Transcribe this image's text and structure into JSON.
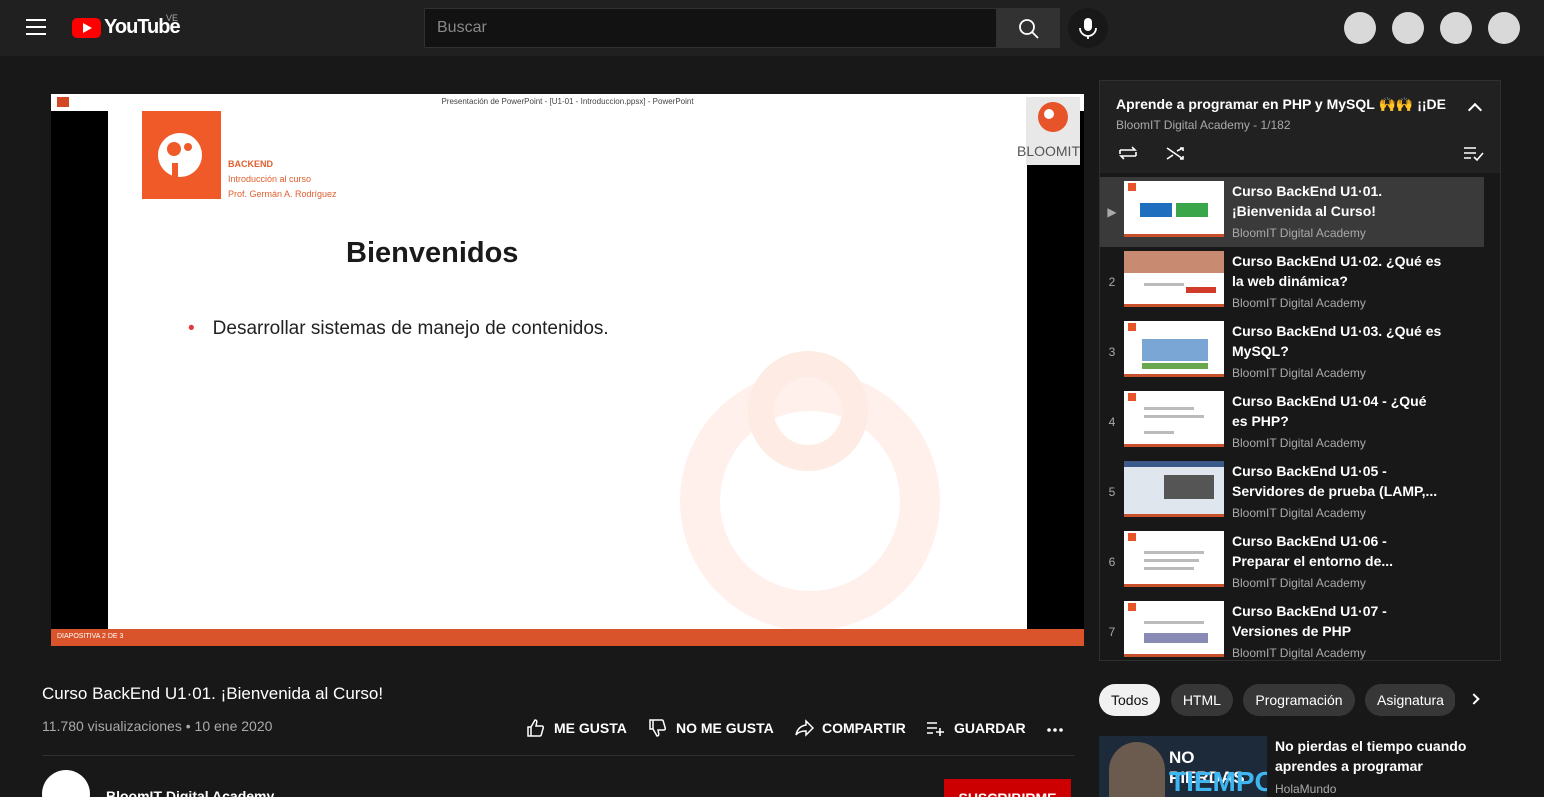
{
  "header": {
    "logo_text": "YouTube",
    "country_code": "VE",
    "search_placeholder": "Buscar"
  },
  "player": {
    "window_title": "Presentación de PowerPoint - [U1-01 - Introduccion.ppsx] - PowerPoint",
    "slide": {
      "section": "BACKEND",
      "subtitle": "Introducción al curso",
      "author": "Prof. Germán A. Rodríguez",
      "heading": "Bienvenidos",
      "bullet": "Desarrollar sistemas de manejo de contenidos.",
      "brand": "BLOOMIT"
    },
    "status": "DIAPOSITIVA 2 DE 3"
  },
  "video": {
    "title": "Curso BackEnd U1·01. ¡Bienvenida al Curso!",
    "views": "11.780 visualizaciones",
    "date": "10 ene 2020",
    "like_label": "ME GUSTA",
    "dislike_label": "NO ME GUSTA",
    "share_label": "COMPARTIR",
    "save_label": "GUARDAR"
  },
  "channel": {
    "name": "BloomIT Digital Academy",
    "subscribe_label": "SUSCRIBIRME"
  },
  "playlist": {
    "title": "Aprende a programar en PHP y MySQL 🙌🙌 ¡¡DE",
    "subtitle": "BloomIT Digital Academy - 1/182",
    "items": [
      {
        "index": "▶",
        "title": "Curso BackEnd U1·01. ¡Bienvenida al Curso!",
        "channel": "BloomIT Digital Academy"
      },
      {
        "index": "2",
        "title": "Curso BackEnd U1·02. ¿Qué es la web dinámica?",
        "channel": "BloomIT Digital Academy"
      },
      {
        "index": "3",
        "title": "Curso BackEnd U1·03. ¿Qué es MySQL?",
        "channel": "BloomIT Digital Academy"
      },
      {
        "index": "4",
        "title": "Curso BackEnd U1·04 - ¿Qué es PHP?",
        "channel": "BloomIT Digital Academy"
      },
      {
        "index": "5",
        "title": "Curso BackEnd U1·05 - Servidores de prueba (LAMP,...",
        "channel": "BloomIT Digital Academy"
      },
      {
        "index": "6",
        "title": "Curso BackEnd U1·06 - Preparar el entorno de...",
        "channel": "BloomIT Digital Academy"
      },
      {
        "index": "7",
        "title": "Curso BackEnd U1·07 - Versiones de PHP",
        "channel": "BloomIT Digital Academy"
      }
    ]
  },
  "chips": [
    "Todos",
    "HTML",
    "Programación",
    "Asignatura"
  ],
  "recommended": {
    "thumb_line1": "NO PIERDAS",
    "thumb_line2": "TIEMPO",
    "title": "No pierdas el tiempo cuando aprendes a programar",
    "channel": "HolaMundo"
  },
  "colors": {
    "brand_red": "#ff0000",
    "slide_orange": "#f05a28",
    "subscribe_red": "#cc0000"
  }
}
